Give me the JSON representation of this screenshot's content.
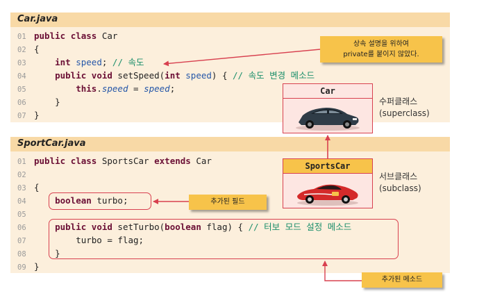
{
  "car_file": {
    "title": "Car.java",
    "lines": [
      {
        "num": "01",
        "parts": [
          {
            "t": "public",
            "c": "kw"
          },
          {
            "t": " "
          },
          {
            "t": "class",
            "c": "kw"
          },
          {
            "t": " Car"
          }
        ]
      },
      {
        "num": "02",
        "parts": [
          {
            "t": "{"
          }
        ]
      },
      {
        "num": "03",
        "parts": [
          {
            "t": "    "
          },
          {
            "t": "int",
            "c": "kw"
          },
          {
            "t": " "
          },
          {
            "t": "speed",
            "c": "vr"
          },
          {
            "t": "; "
          },
          {
            "t": "// 속도",
            "c": "cm"
          }
        ]
      },
      {
        "num": "04",
        "parts": [
          {
            "t": "    "
          },
          {
            "t": "public",
            "c": "kw"
          },
          {
            "t": " "
          },
          {
            "t": "void",
            "c": "kw"
          },
          {
            "t": " setSpeed("
          },
          {
            "t": "int",
            "c": "kw"
          },
          {
            "t": " "
          },
          {
            "t": "speed",
            "c": "vr"
          },
          {
            "t": ") { "
          },
          {
            "t": "// 속도 변경 메소드",
            "c": "cm"
          }
        ]
      },
      {
        "num": "05",
        "parts": [
          {
            "t": "        "
          },
          {
            "t": "this",
            "c": "kw"
          },
          {
            "t": "."
          },
          {
            "t": "speed",
            "c": "it"
          },
          {
            "t": " = "
          },
          {
            "t": "speed",
            "c": "it"
          },
          {
            "t": ";"
          }
        ]
      },
      {
        "num": "06",
        "parts": [
          {
            "t": "    }"
          }
        ]
      },
      {
        "num": "07",
        "parts": [
          {
            "t": "}"
          }
        ]
      }
    ]
  },
  "sportscar_file": {
    "title": "SportCar.java",
    "lines": [
      {
        "num": "01",
        "parts": [
          {
            "t": "public",
            "c": "kw"
          },
          {
            "t": " "
          },
          {
            "t": "class",
            "c": "kw"
          },
          {
            "t": " SportsCar "
          },
          {
            "t": "extends",
            "c": "kw"
          },
          {
            "t": " Car"
          }
        ]
      },
      {
        "num": "02",
        "parts": [
          {
            "t": ""
          }
        ]
      },
      {
        "num": "03",
        "parts": [
          {
            "t": "{"
          }
        ]
      },
      {
        "num": "04",
        "parts": [
          {
            "t": "    "
          },
          {
            "t": "boolean",
            "c": "kw"
          },
          {
            "t": " turbo;"
          }
        ]
      },
      {
        "num": "05",
        "parts": [
          {
            "t": ""
          }
        ]
      },
      {
        "num": "06",
        "parts": [
          {
            "t": "    "
          },
          {
            "t": "public",
            "c": "kw"
          },
          {
            "t": " "
          },
          {
            "t": "void",
            "c": "kw"
          },
          {
            "t": " setTurbo("
          },
          {
            "t": "boolean",
            "c": "kw"
          },
          {
            "t": " flag) { "
          },
          {
            "t": "// 터보 모드 설정 메소드",
            "c": "cm"
          }
        ]
      },
      {
        "num": "07",
        "parts": [
          {
            "t": "        turbo = flag;"
          }
        ]
      },
      {
        "num": "08",
        "parts": [
          {
            "t": "    }"
          }
        ]
      },
      {
        "num": "09",
        "parts": [
          {
            "t": "}"
          }
        ]
      }
    ]
  },
  "callouts": {
    "private_note_line1": "상속 설명을 위하여",
    "private_note_line2": "private를 붙이지 않았다.",
    "added_field": "추가된 필드",
    "added_method": "추가된 메소드"
  },
  "hierarchy": {
    "superclass_name": "Car",
    "superclass_label_ko": "수퍼클래스",
    "superclass_label_en": "(superclass)",
    "subclass_name": "SportsCar",
    "subclass_label_ko": "서브클래스",
    "subclass_label_en": "(subclass)"
  },
  "colors": {
    "accent_red": "#d8404f",
    "callout_yellow": "#f7c34a",
    "code_background": "#fcefdc",
    "keyword": "#6b0f35",
    "comment": "#1b8f6b"
  }
}
